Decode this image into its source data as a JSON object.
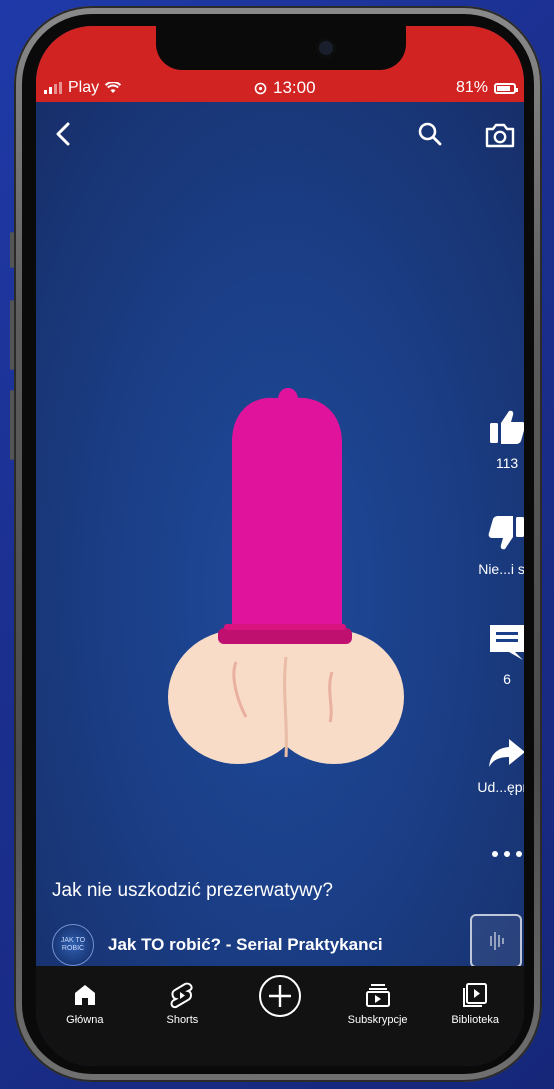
{
  "status_bar": {
    "carrier": "Play",
    "time": "13:00",
    "battery": "81%"
  },
  "video": {
    "caption": "Jak nie uszkodzić prezerwatywy?",
    "channel_name": "Jak TO robić? - Serial Praktykanci",
    "channel_avatar_text": "JAK TO ROBIĆ"
  },
  "actions": {
    "like_count": "113",
    "dislike_label": "Nie...i się",
    "comment_count": "6",
    "share_label": "Ud...ępnij"
  },
  "bottom_nav": {
    "items": [
      {
        "label": "Główna",
        "icon": "home-icon"
      },
      {
        "label": "Shorts",
        "icon": "shorts-icon"
      },
      {
        "label": "",
        "icon": "create-icon"
      },
      {
        "label": "Subskrypcje",
        "icon": "subscriptions-icon"
      },
      {
        "label": "Biblioteka",
        "icon": "library-icon"
      }
    ]
  },
  "colors": {
    "status_bar": "#d22323",
    "video_bg": "#1b3f88",
    "nav_bg": "#121212",
    "condom": "#e0149c",
    "skin": "#f8dcc8"
  }
}
